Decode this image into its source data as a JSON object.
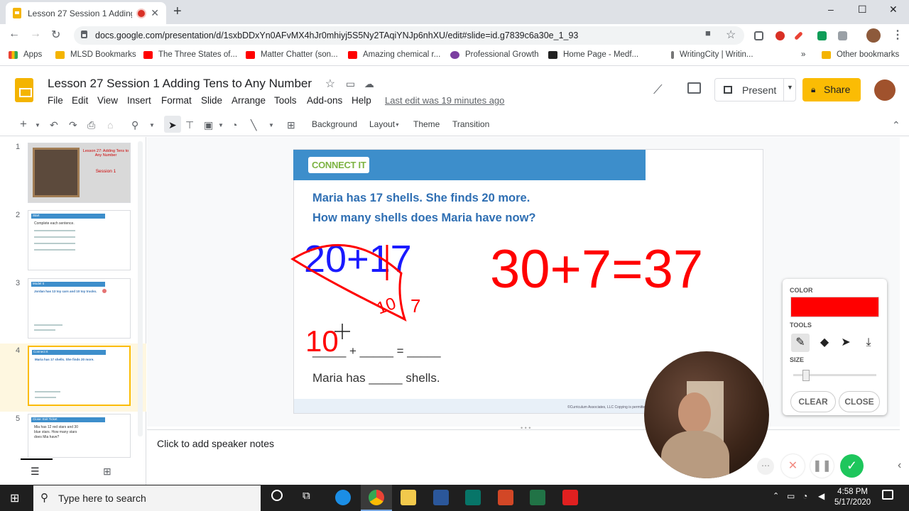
{
  "browser": {
    "tab_title": "Lesson 27 Session 1 Adding",
    "tab_close": "✕",
    "new_tab": "+",
    "url": "docs.google.com/presentation/d/1sxbDDxYn0AFvMX4hJr0mhiyj5S5Ny2TAqiYNJp6nhXU/edit#slide=id.g7839c6a30e_1_93",
    "window_controls": [
      "–",
      "☐",
      "✕"
    ]
  },
  "bookmarks": {
    "apps_label": "Apps",
    "items": [
      {
        "label": "MLSD Bookmarks",
        "color": "#f4b400"
      },
      {
        "label": "The Three States of...",
        "color": "#ff0000"
      },
      {
        "label": "Matter Chatter (son...",
        "color": "#ff0000"
      },
      {
        "label": "Amazing chemical r...",
        "color": "#ff0000"
      },
      {
        "label": "Professional Growth",
        "color": "#7b3fa0"
      },
      {
        "label": "Home Page - Medf...",
        "color": "#222222"
      },
      {
        "label": "WritingCity | Writin...",
        "color": "#555555"
      }
    ],
    "overflow": "»",
    "other_label": "Other bookmarks"
  },
  "doc": {
    "title": "Lesson 27 Session 1 Adding Tens to Any Number",
    "menus": [
      "File",
      "Edit",
      "View",
      "Insert",
      "Format",
      "Slide",
      "Arrange",
      "Tools",
      "Add-ons",
      "Help"
    ],
    "last_edit": "Last edit was 19 minutes ago",
    "present_label": "Present",
    "share_label": "Share"
  },
  "toolbar": {
    "background_label": "Background",
    "layout_label": "Layout",
    "theme_label": "Theme",
    "transition_label": "Transition"
  },
  "filmstrip": {
    "slides": [
      {
        "number": "1",
        "title": "Lesson 27: Adding Tens to Any Number",
        "subtitle": "Session 1"
      },
      {
        "number": "2",
        "title": "Start",
        "subtitle": "Complete each sentence."
      },
      {
        "number": "3",
        "title": "Model It",
        "subtitle": "Jordan has 13 toy cars and 10 toy trucks."
      },
      {
        "number": "4",
        "title": "Connect It",
        "subtitle": "Maria has 17 shells. She finds 20 more."
      },
      {
        "number": "5",
        "title": "Close: Exit Ticket",
        "subtitle": "Mia has 12 red stars and 30 blue stars. How many stars does Mia have?"
      }
    ],
    "selected": 4
  },
  "slide": {
    "tag": "CONNECT IT",
    "question_line1": "Maria has 17 shells. She finds 20 more.",
    "question_line2": "How many shells does Maria have now?",
    "equation_line": "_____ + _____ = _____",
    "answer_line": "Maria has _____ shells.",
    "footer": "©Curriculum Associates, LLC   Copying is permitted.",
    "ink": {
      "blue_expr": "20+17",
      "red_result": "30+7=37",
      "red_ten": "10",
      "red_seven": "7",
      "red_written": "10",
      "ink_color": "#ff0000",
      "blue_color": "#1a1aff"
    }
  },
  "notes": {
    "placeholder": "Click to add speaker notes"
  },
  "pen_panel": {
    "color_label": "COLOR",
    "selected_color": "#ff0000",
    "tools_label": "TOOLS",
    "size_label": "SIZE",
    "size_level": 0.15,
    "clear_label": "CLEAR",
    "close_label": "CLOSE"
  },
  "taskbar": {
    "search_placeholder": "Type here to search",
    "time": "4:58 PM",
    "date": "5/17/2020"
  }
}
